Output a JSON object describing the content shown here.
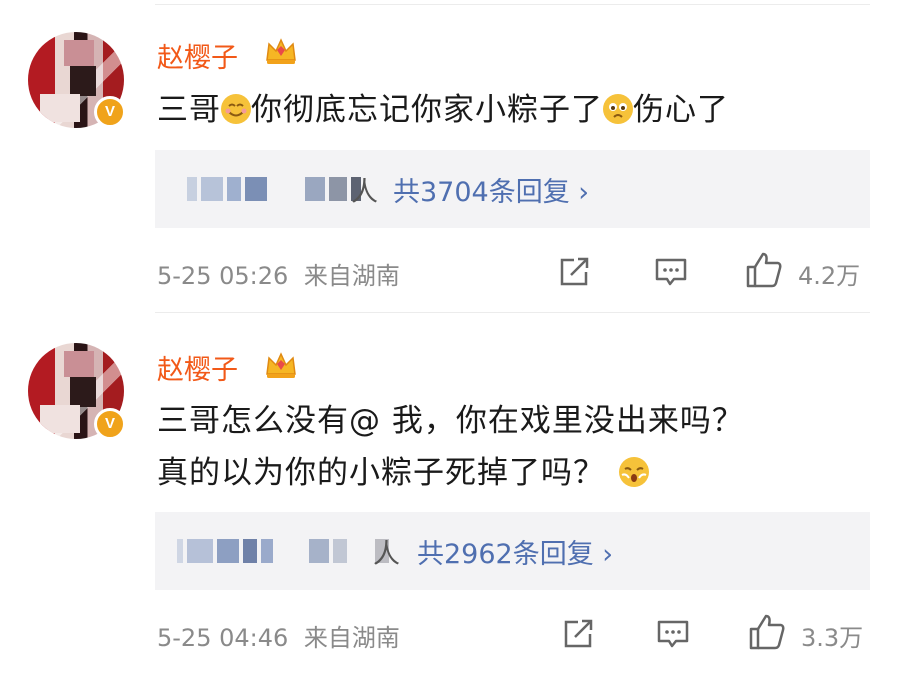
{
  "comments": [
    {
      "username": "赵樱子",
      "text_parts": [
        "三哥",
        "你彻底忘记你家小粽子了",
        "伤心了"
      ],
      "reply_suffix": "人",
      "reply_count": "共3704条回复 ›",
      "time": "5-25 05:26",
      "location": "来自湖南",
      "likes": "4.2万"
    },
    {
      "username": "赵樱子",
      "text_line1": "三哥怎么没有@ 我，你在戏里没出来吗？",
      "text_line2": "真的以为你的小粽子死掉了吗？",
      "reply_suffix": "人",
      "reply_count": "共2962条回复 ›",
      "time": "5-25 04:46",
      "location": "来自湖南",
      "likes": "3.3万"
    }
  ],
  "colors": {
    "username": "#f25918",
    "link": "#4f6fb0",
    "meta": "#8a8a8a",
    "badge": "#f0a31b"
  },
  "icons": [
    "crown-icon",
    "verified-badge-icon",
    "smile-emoji",
    "sad-emoji",
    "shy-emoji",
    "share-icon",
    "comment-icon",
    "like-icon"
  ]
}
